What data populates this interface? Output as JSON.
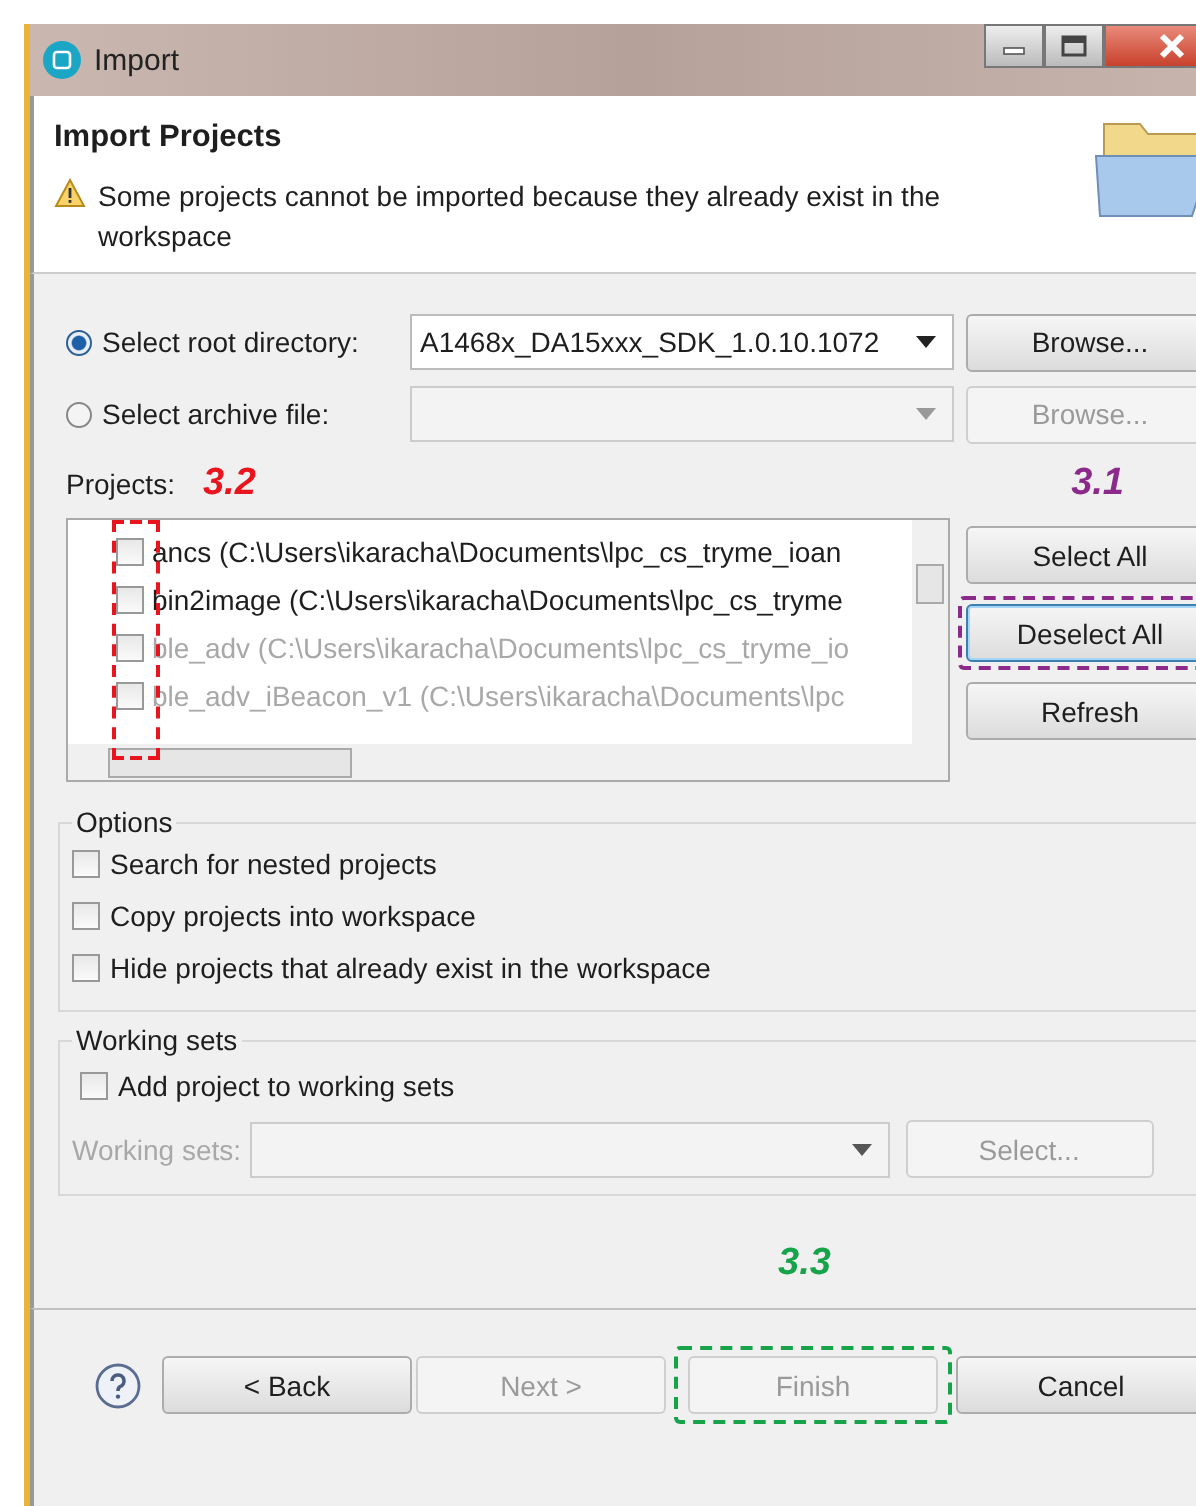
{
  "window": {
    "title": "Import"
  },
  "header": {
    "title": "Import Projects",
    "message": "Some projects cannot be imported because they already exist in the workspace"
  },
  "sources": [
    {
      "label": "Select root directory:",
      "selected": true,
      "value": "A1468x_DA15xxx_SDK_1.0.10.1072",
      "button": "Browse...",
      "disabled": false
    },
    {
      "label": "Select archive file:",
      "selected": false,
      "button": "Browse...",
      "disabled": true
    }
  ],
  "projects": {
    "label": "Projects:",
    "items": [
      {
        "name": "ancs (C:\\Users\\ikaracha\\Documents\\lpc_cs_tryme_ioan",
        "checked": false,
        "disabled": false
      },
      {
        "name": "bin2image (C:\\Users\\ikaracha\\Documents\\lpc_cs_tryme",
        "checked": false,
        "disabled": false
      },
      {
        "name": "ble_adv (C:\\Users\\ikaracha\\Documents\\lpc_cs_tryme_io",
        "checked": false,
        "disabled": true
      },
      {
        "name": "ble_adv_iBeacon_v1 (C:\\Users\\ikaracha\\Documents\\lpc",
        "checked": false,
        "disabled": true
      }
    ]
  },
  "project_buttons": [
    {
      "label": "Select All",
      "focused": false
    },
    {
      "label": "Deselect All",
      "focused": true
    },
    {
      "label": "Refresh",
      "focused": false
    }
  ],
  "options": {
    "title": "Options",
    "items": [
      {
        "label": "Search for nested projects",
        "checked": false
      },
      {
        "label": "Copy projects into workspace",
        "checked": false
      },
      {
        "label": "Hide projects that already exist in the workspace",
        "checked": false
      }
    ]
  },
  "working_sets": {
    "title": "Working sets",
    "checkbox": {
      "label": "Add project to working sets",
      "checked": false
    },
    "field_label": "Working sets:",
    "button": "Select...",
    "disabled": true
  },
  "footer": {
    "buttons": [
      {
        "label": "< Back",
        "disabled": false
      },
      {
        "label": "Next >",
        "disabled": true
      },
      {
        "label": "Finish",
        "disabled": true
      },
      {
        "label": "Cancel",
        "disabled": false
      }
    ]
  },
  "annotations": [
    {
      "label": "3.2",
      "color": "#e8141e"
    },
    {
      "label": "3.1",
      "color": "#8b2a8b"
    },
    {
      "label": "3.3",
      "color": "#17a34a"
    }
  ]
}
